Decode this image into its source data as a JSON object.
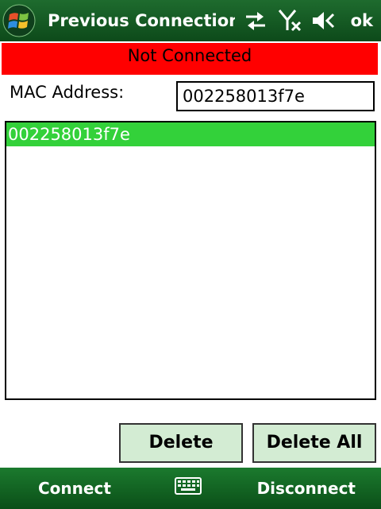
{
  "titlebar": {
    "title": "Previous Connection Vi",
    "ok_label": "ok",
    "icons": [
      "windows-start-icon",
      "connectivity-icon",
      "signal-off-icon",
      "volume-muted-icon"
    ]
  },
  "status": {
    "text": "Not Connected",
    "color": "#ff0000"
  },
  "mac": {
    "label": "MAC Address:",
    "value": "002258013f7e"
  },
  "list": {
    "items": [
      "002258013f7e"
    ],
    "selected_index": 0,
    "selected_color": "#33d13a"
  },
  "buttons": {
    "delete": "Delete",
    "delete_all": "Delete All"
  },
  "softkeys": {
    "left": "Connect",
    "right": "Disconnect",
    "center_icon": "keyboard-icon"
  }
}
